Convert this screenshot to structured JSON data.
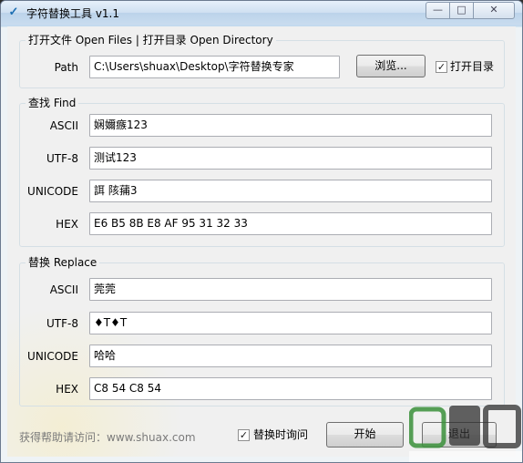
{
  "window": {
    "title": "字符替换工具 v1.1",
    "icon": "app-logo-icon",
    "controls": {
      "minimize": "—",
      "maximize": "□",
      "close": "✕"
    }
  },
  "path_group": {
    "title": "打开文件 Open Files | 打开目录 Open Directory",
    "path_label": "Path",
    "path_value": "C:\\Users\\shuax\\Desktop\\字符替换专家",
    "browse_label": "浏览...",
    "open_dir_label": "打开目录",
    "open_dir_checked": true
  },
  "find_group": {
    "title": "查找 Find",
    "rows": [
      {
        "label": "ASCII",
        "value": "娴嬭瘯123"
      },
      {
        "label": "UTF-8",
        "value": "测试123"
      },
      {
        "label": "UNICODE",
        "value": "誀   陔蒱3"
      },
      {
        "label": "HEX",
        "value": "E6 B5 8B E8 AF 95 31 32 33"
      }
    ]
  },
  "replace_group": {
    "title": "替换 Replace",
    "rows": [
      {
        "label": "ASCII",
        "value": "莞莞"
      },
      {
        "label": "UTF-8",
        "value": "♦T♦T"
      },
      {
        "label": "UNICODE",
        "value": "哈哈"
      },
      {
        "label": "HEX",
        "value": "C8 54 C8 54"
      }
    ]
  },
  "footer": {
    "help_text": "获得帮助请访问：www.shuax.com",
    "replace_time_label": "替换时询问",
    "replace_time_checked": true,
    "start_label": "开始",
    "exit_label": "退出"
  },
  "colors": {
    "field_text": "#000000",
    "group_border": "#d5dfe5",
    "accent": "#1d6fb3"
  }
}
